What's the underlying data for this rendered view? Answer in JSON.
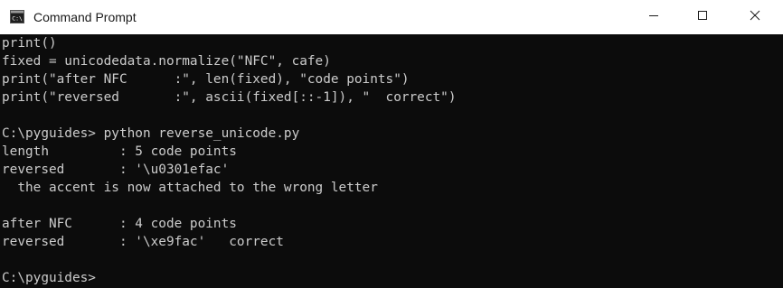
{
  "window": {
    "title": "Command Prompt",
    "icon": "cmd-icon",
    "controls": [
      "minimize-icon",
      "maximize-icon",
      "close-icon"
    ]
  },
  "colors": {
    "titlebar_bg": "#ffffff",
    "console_bg": "#0c0c0c",
    "console_fg": "#cccccc"
  },
  "console": {
    "lines": [
      "print()",
      "fixed = unicodedata.normalize(\"NFC\", cafe)",
      "print(\"after NFC      :\", len(fixed), \"code points\")",
      "print(\"reversed       :\", ascii(fixed[::-1]), \"  correct\")",
      "",
      "C:\\pyguides> python reverse_unicode.py",
      "length         : 5 code points",
      "reversed       : '\\u0301efac'",
      "  the accent is now attached to the wrong letter",
      "",
      "after NFC      : 4 code points",
      "reversed       : '\\xe9fac'   correct",
      "",
      "C:\\pyguides>"
    ]
  }
}
